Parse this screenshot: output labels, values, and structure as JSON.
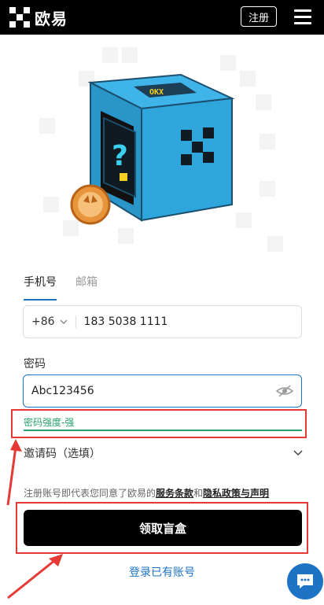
{
  "header": {
    "brand": "欧易",
    "register_label": "注册"
  },
  "tabs": [
    {
      "label": "手机号"
    },
    {
      "label": "邮箱"
    }
  ],
  "phone": {
    "country_code": "+86",
    "number": "183 5038 1111"
  },
  "password": {
    "label": "密码",
    "value": "Abc123456"
  },
  "strength": {
    "text": "密码强度-强"
  },
  "invite": {
    "label": "邀请码（选填）"
  },
  "terms": {
    "prefix": "注册账号即代表您同意了欧易的",
    "link1": "服务条款",
    "mid": "和",
    "link2": "隐私政策与声明"
  },
  "submit_label": "领取盲盒",
  "login_link": "登录已有账号",
  "colors": {
    "accent": "#1e73c4",
    "strength": "#27a06b",
    "highlight": "#e53935"
  }
}
